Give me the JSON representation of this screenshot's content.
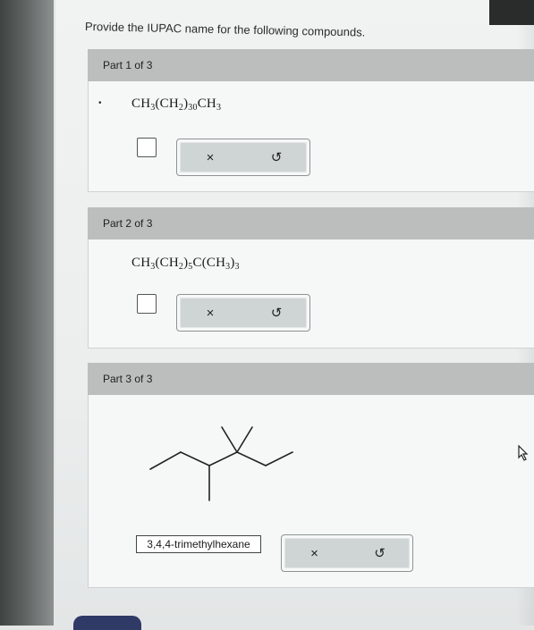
{
  "prompt": "Provide the IUPAC name for the following compounds.",
  "parts": [
    {
      "header": "Part 1 of 3",
      "formula_parts": [
        "CH",
        "3",
        "(CH",
        "2",
        ")",
        "30",
        "CH",
        "3"
      ],
      "checkbox_checked": false,
      "clear_button": "×",
      "reset_button": "↺"
    },
    {
      "header": "Part 2 of 3",
      "formula_parts": [
        "CH",
        "3",
        "(CH",
        "2",
        ")",
        "5",
        "C(CH",
        "3",
        ")",
        "3"
      ],
      "checkbox_checked": false,
      "clear_button": "×",
      "reset_button": "↺"
    },
    {
      "header": "Part 3 of 3",
      "structure": "skeletal-structure",
      "answer": "3,4,4-trimethylhexane",
      "clear_button": "×",
      "reset_button": "↺"
    }
  ]
}
